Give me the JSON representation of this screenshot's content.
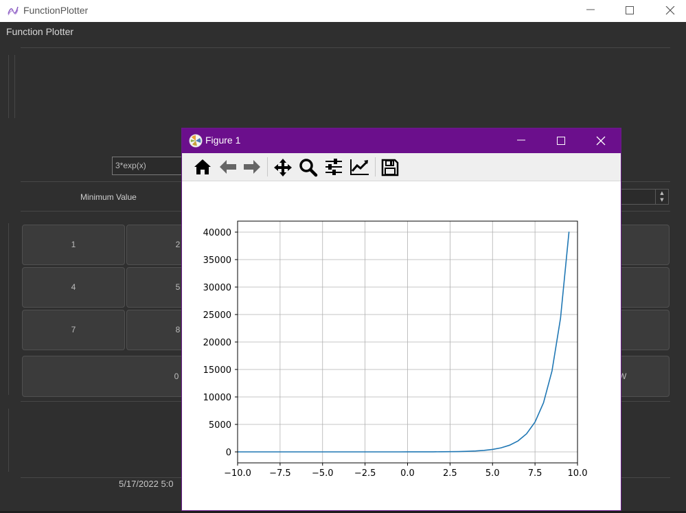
{
  "window": {
    "title": "FunctionPlotter"
  },
  "app": {
    "label": "Function Plotter",
    "function_input": "3*exp(x)",
    "min_label": "Minimum Value",
    "keys": [
      "1",
      "2",
      "4",
      "5",
      "7",
      "8",
      "0",
      "W"
    ],
    "date_text": "5/17/2022 5:0"
  },
  "figure": {
    "title": "Figure 1",
    "toolbar_icons": [
      "home-icon",
      "back-arrow-icon",
      "forward-arrow-icon",
      "pan-icon",
      "zoom-icon",
      "configure-subplots-icon",
      "edit-axis-icon",
      "save-icon"
    ]
  },
  "chart_data": {
    "type": "line",
    "title": "",
    "xlabel": "",
    "ylabel": "",
    "xlim": [
      -10,
      10
    ],
    "ylim": [
      -2000,
      42000
    ],
    "grid": true,
    "x_ticks": [
      "−10.0",
      "−7.5",
      "−5.0",
      "−2.5",
      "0.0",
      "2.5",
      "5.0",
      "7.5",
      "10.0"
    ],
    "x_tick_values": [
      -10,
      -7.5,
      -5,
      -2.5,
      0,
      2.5,
      5,
      7.5,
      10
    ],
    "y_ticks": [
      "0",
      "5000",
      "10000",
      "15000",
      "20000",
      "25000",
      "30000",
      "35000",
      "40000"
    ],
    "y_tick_values": [
      0,
      5000,
      10000,
      15000,
      20000,
      25000,
      30000,
      35000,
      40000
    ],
    "series": [
      {
        "color": "#1f77b4",
        "x": [
          -10,
          -9.5,
          -9,
          -8.5,
          -8,
          -7.5,
          -7,
          -6.5,
          -6,
          -5.5,
          -5,
          -4.5,
          -4,
          -3.5,
          -3,
          -2.5,
          -2,
          -1.5,
          -1,
          -0.5,
          0,
          0.5,
          1,
          1.5,
          2,
          2.5,
          3,
          3.5,
          4,
          4.5,
          5,
          5.5,
          6,
          6.5,
          7,
          7.5,
          8,
          8.5,
          9,
          9.5
        ],
        "y": [
          0.0001,
          0.0002,
          0.0004,
          0.0006,
          0.001,
          0.0017,
          0.0027,
          0.0045,
          0.0074,
          0.012,
          0.02,
          0.033,
          0.055,
          0.09,
          0.149,
          0.246,
          0.406,
          0.669,
          1.1,
          1.82,
          3,
          4.95,
          8.15,
          13.4,
          22.2,
          36.5,
          60.3,
          99.4,
          164,
          270,
          445,
          734,
          1210,
          1995,
          3290,
          5424,
          8943,
          14745,
          24310,
          40080
        ]
      }
    ]
  }
}
